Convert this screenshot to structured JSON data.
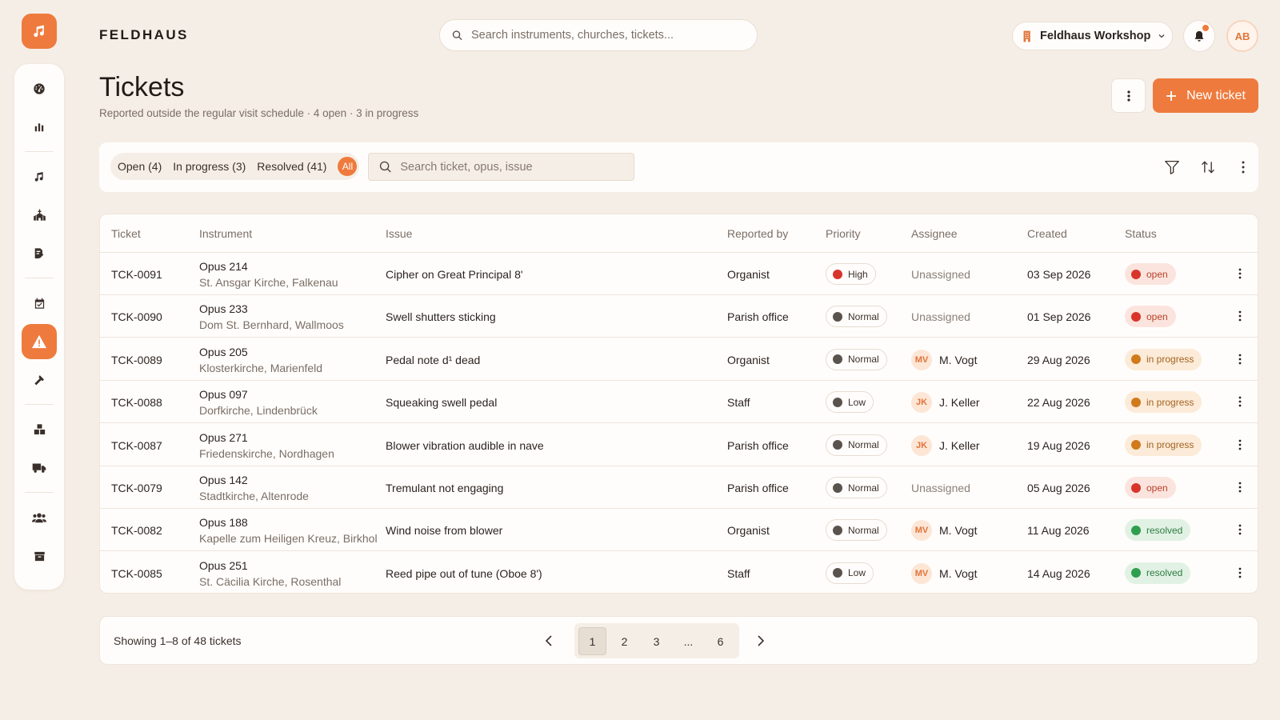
{
  "brand": {
    "name": "FELDHAUS"
  },
  "search": {
    "placeholder": "Search instruments, churches, tickets..."
  },
  "workspace": {
    "label": "Feldhaus Workshop"
  },
  "user": {
    "initials": "AB"
  },
  "page": {
    "title": "Tickets",
    "subtitle": "Reported outside the regular visit schedule · 4 open · 3 in progress",
    "new_button": "New ticket"
  },
  "filters": {
    "open": "Open (4)",
    "in_progress": "In progress (3)",
    "resolved": "Resolved (41)",
    "all": "All",
    "search_placeholder": "Search ticket, opus, issue"
  },
  "table": {
    "headers": [
      "Ticket",
      "Instrument",
      "Issue",
      "Reported by",
      "Priority",
      "Assignee",
      "Created",
      "Status"
    ],
    "rows": [
      {
        "id": "TCK-0091",
        "opus": "Opus 214",
        "location": "St. Ansgar Kirche, Falkenau",
        "issue": "Cipher on Great Principal 8'",
        "reported_by": "Organist",
        "priority": "High",
        "assignee_initials": "",
        "assignee": "Unassigned",
        "created": "03 Sep 2026",
        "status": "open"
      },
      {
        "id": "TCK-0090",
        "opus": "Opus 233",
        "location": "Dom St. Bernhard, Wallmoos",
        "issue": "Swell shutters sticking",
        "reported_by": "Parish office",
        "priority": "Normal",
        "assignee_initials": "",
        "assignee": "Unassigned",
        "created": "01 Sep 2026",
        "status": "open"
      },
      {
        "id": "TCK-0089",
        "opus": "Opus 205",
        "location": "Klosterkirche, Marienfeld",
        "issue": "Pedal note d¹ dead",
        "reported_by": "Organist",
        "priority": "Normal",
        "assignee_initials": "MV",
        "assignee": "M. Vogt",
        "created": "29 Aug 2026",
        "status": "in progress"
      },
      {
        "id": "TCK-0088",
        "opus": "Opus 097",
        "location": "Dorfkirche, Lindenbrück",
        "issue": "Squeaking swell pedal",
        "reported_by": "Staff",
        "priority": "Low",
        "assignee_initials": "JK",
        "assignee": "J. Keller",
        "created": "22 Aug 2026",
        "status": "in progress"
      },
      {
        "id": "TCK-0087",
        "opus": "Opus 271",
        "location": "Friedenskirche, Nordhagen",
        "issue": "Blower vibration audible in nave",
        "reported_by": "Parish office",
        "priority": "Normal",
        "assignee_initials": "JK",
        "assignee": "J. Keller",
        "created": "19 Aug 2026",
        "status": "in progress"
      },
      {
        "id": "TCK-0079",
        "opus": "Opus 142",
        "location": "Stadtkirche, Altenrode",
        "issue": "Tremulant not engaging",
        "reported_by": "Parish office",
        "priority": "Normal",
        "assignee_initials": "",
        "assignee": "Unassigned",
        "created": "05 Aug 2026",
        "status": "open"
      },
      {
        "id": "TCK-0082",
        "opus": "Opus 188",
        "location": "Kapelle zum Heiligen Kreuz, Birkhol",
        "issue": "Wind noise from blower",
        "reported_by": "Organist",
        "priority": "Normal",
        "assignee_initials": "MV",
        "assignee": "M. Vogt",
        "created": "11 Aug 2026",
        "status": "resolved"
      },
      {
        "id": "TCK-0085",
        "opus": "Opus 251",
        "location": "St. Cäcilia Kirche, Rosenthal",
        "issue": "Reed pipe out of tune (Oboe 8')",
        "reported_by": "Staff",
        "priority": "Low",
        "assignee_initials": "MV",
        "assignee": "M. Vogt",
        "created": "14 Aug 2026",
        "status": "resolved"
      }
    ]
  },
  "pagination": {
    "showing": "Showing 1–8 of 48 tickets",
    "pages": [
      "1",
      "2",
      "3",
      "...",
      "6"
    ]
  },
  "colors": {
    "accent": "#ee7b3d",
    "priority_high": "#d9342b",
    "priority_other": "#5a524d",
    "status_open": "#d9342b",
    "status_progress": "#d07a1c",
    "status_resolved": "#2f9e4f"
  }
}
